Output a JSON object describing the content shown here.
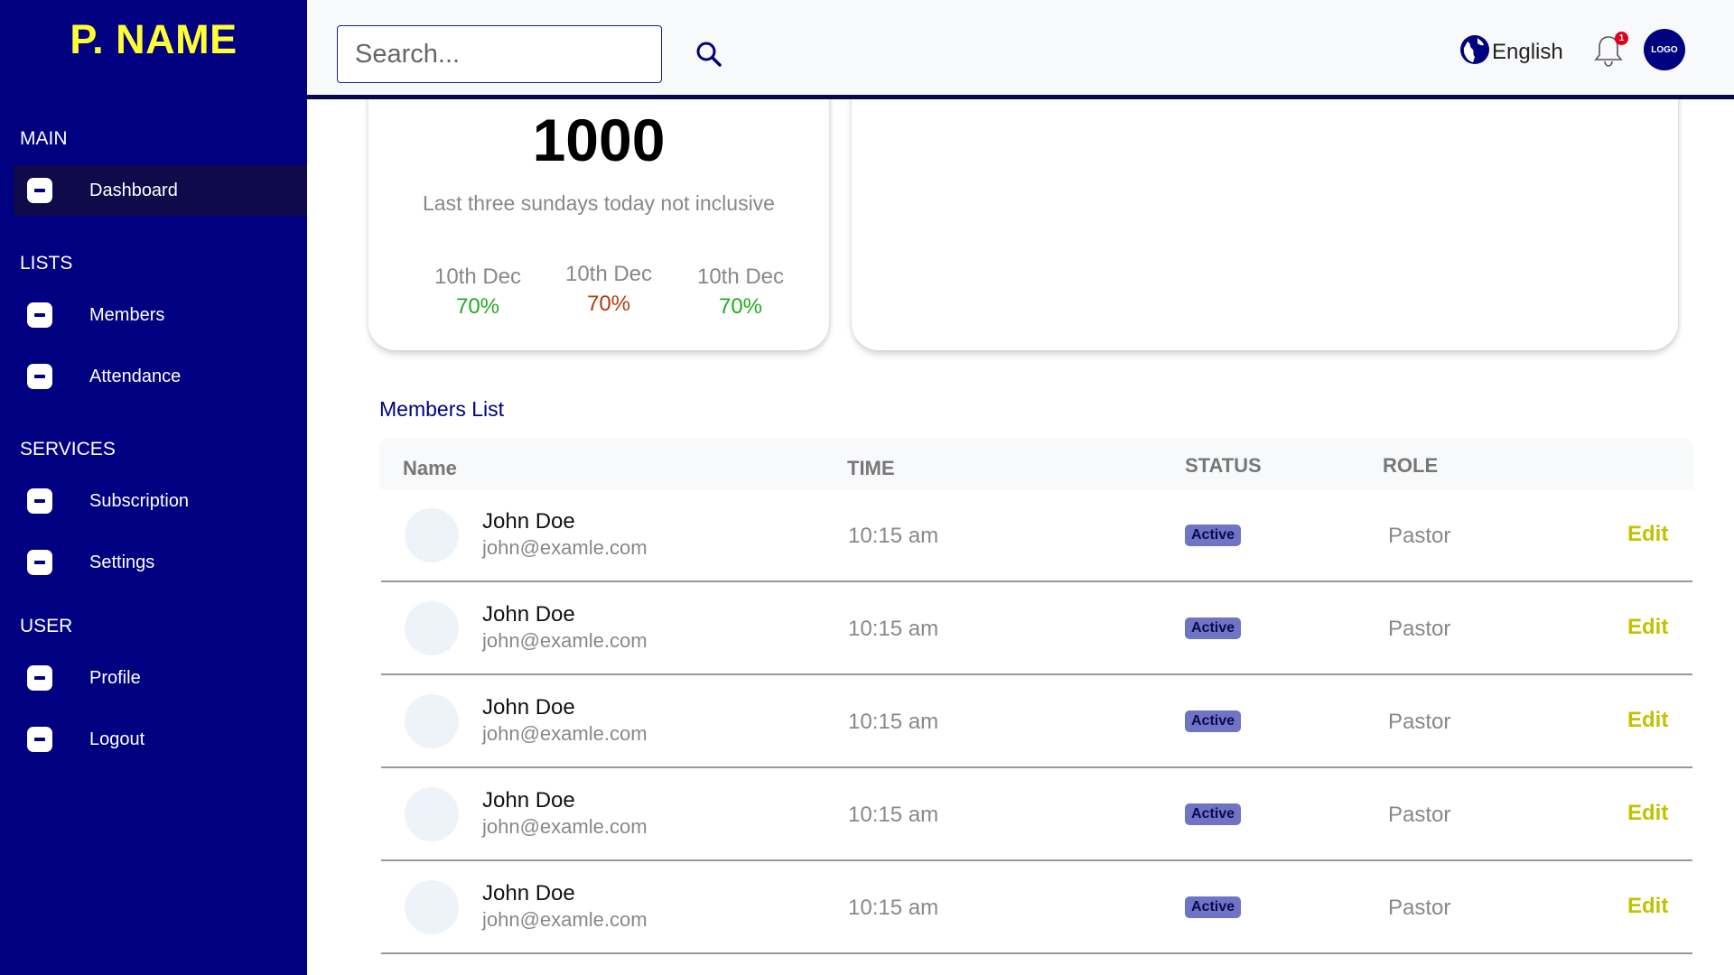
{
  "brand": "P. NAME",
  "sidebar": {
    "sections": [
      {
        "label": "MAIN",
        "items": [
          {
            "label": "Dashboard",
            "icon": "dashboard-icon",
            "active": true
          }
        ]
      },
      {
        "label": "LISTS",
        "items": [
          {
            "label": "Members",
            "icon": "members-icon"
          },
          {
            "label": "Attendance",
            "icon": "attendance-icon"
          }
        ]
      },
      {
        "label": "SERVICES",
        "items": [
          {
            "label": "Subscription",
            "icon": "subscription-icon"
          },
          {
            "label": "Settings",
            "icon": "settings-icon"
          }
        ]
      },
      {
        "label": "USER",
        "items": [
          {
            "label": "Profile",
            "icon": "profile-icon"
          },
          {
            "label": "Logout",
            "icon": "logout-icon"
          }
        ]
      }
    ]
  },
  "header": {
    "search_placeholder": "Search...",
    "language": "English",
    "notification_count": "1",
    "avatar_text": "LOGO"
  },
  "stats_card": {
    "total": "1000",
    "caption": "Last three sundays today not inclusive",
    "stats": [
      {
        "date": "10th Dec",
        "percent": "70%",
        "color": "#22aa22"
      },
      {
        "date": "10th Dec",
        "percent": "70%",
        "color": "#b33a10"
      },
      {
        "date": "10th Dec",
        "percent": "70%",
        "color": "#22aa22"
      }
    ]
  },
  "members_list": {
    "title": "Members List",
    "columns": [
      "Name",
      "TIME",
      "STATUS",
      "ROLE"
    ],
    "rows": [
      {
        "name": "John Doe",
        "email": "john@examle.com",
        "time": "10:15 am",
        "status": "Active",
        "role": "Pastor",
        "action": "Edit"
      },
      {
        "name": "John Doe",
        "email": "john@examle.com",
        "time": "10:15 am",
        "status": "Active",
        "role": "Pastor",
        "action": "Edit"
      },
      {
        "name": "John Doe",
        "email": "john@examle.com",
        "time": "10:15 am",
        "status": "Active",
        "role": "Pastor",
        "action": "Edit"
      },
      {
        "name": "John Doe",
        "email": "john@examle.com",
        "time": "10:15 am",
        "status": "Active",
        "role": "Pastor",
        "action": "Edit"
      },
      {
        "name": "John Doe",
        "email": "john@examle.com",
        "time": "10:15 am",
        "status": "Active",
        "role": "Pastor",
        "action": "Edit"
      }
    ]
  },
  "colors": {
    "sidebar_bg": "#000080",
    "brand": "#ffff33",
    "edit": "#c2c200",
    "badge": "#6f74c4"
  }
}
